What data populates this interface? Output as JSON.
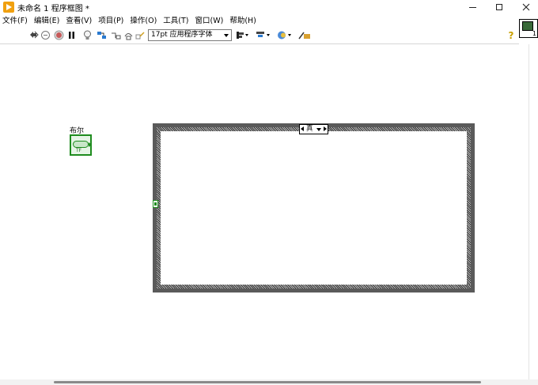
{
  "window": {
    "title": "未命名 1 程序框图 *",
    "controls": {
      "minimize": "minimize-icon",
      "maximize": "maximize-icon",
      "close": "close-icon"
    }
  },
  "menu": {
    "items": [
      {
        "label": "文件(F)"
      },
      {
        "label": "编辑(E)"
      },
      {
        "label": "查看(V)"
      },
      {
        "label": "项目(P)"
      },
      {
        "label": "操作(O)"
      },
      {
        "label": "工具(T)"
      },
      {
        "label": "窗口(W)"
      },
      {
        "label": "帮助(H)"
      }
    ]
  },
  "toolbar": {
    "font_select": "17pt 应用程序字体",
    "help_glyph": "?",
    "vi_icon_number": "1",
    "icons": [
      "run-icon",
      "run-continuously-icon",
      "abort-icon",
      "pause-icon",
      "highlight-execution-icon",
      "retain-wire-values-icon",
      "step-into-icon",
      "step-over-icon",
      "step-out-icon",
      "align-objects-icon",
      "distribute-objects-icon",
      "reorder-icon",
      "cleanup-diagram-icon"
    ]
  },
  "diagram": {
    "boolean_control": {
      "label": "布尔",
      "tf_text": "TF"
    },
    "case_structure": {
      "selector_value": "真"
    }
  },
  "colors": {
    "boolean_terminal": "#1e8c1e",
    "structure_border": "#5a5a5a",
    "app_icon": "#f0a010"
  }
}
